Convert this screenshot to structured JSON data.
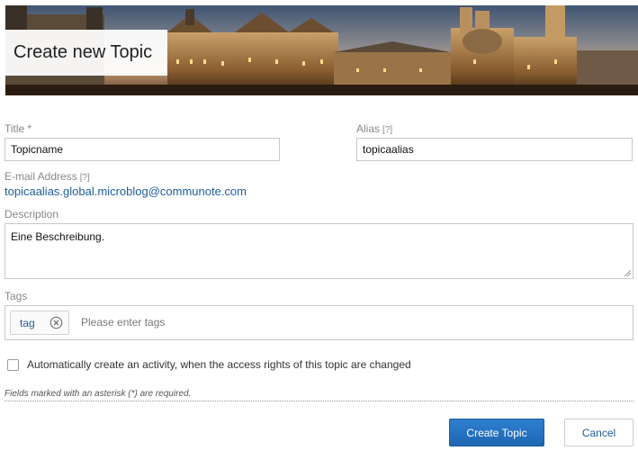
{
  "banner": {
    "title": "Create new Topic",
    "image": "city-skyline-at-dusk"
  },
  "form": {
    "title_field": {
      "label": "Title *",
      "value": "Topicname"
    },
    "alias_field": {
      "label": "Alias",
      "help": "[?]",
      "value": "topicaalias"
    },
    "email": {
      "label": "E-mail Address",
      "help": "[?]",
      "value": "topicaalias.global.microblog@communote.com"
    },
    "description": {
      "label": "Description",
      "value": "Eine Beschreibung."
    },
    "tags": {
      "label": "Tags",
      "items": [
        {
          "label": "tag",
          "remove_icon": "close-circle-icon"
        }
      ],
      "placeholder": "Please enter tags"
    },
    "auto_activity": {
      "label": "Automatically create an activity, when the access rights of this topic are changed",
      "checked": false
    },
    "required_note": "Fields marked with an asterisk (*) are required."
  },
  "actions": {
    "primary_label": "Create Topic",
    "secondary_label": "Cancel"
  },
  "colors": {
    "link": "#1f5d9a",
    "primary_button": "#2471c0",
    "label": "#888888",
    "border": "#c8c8c8"
  }
}
